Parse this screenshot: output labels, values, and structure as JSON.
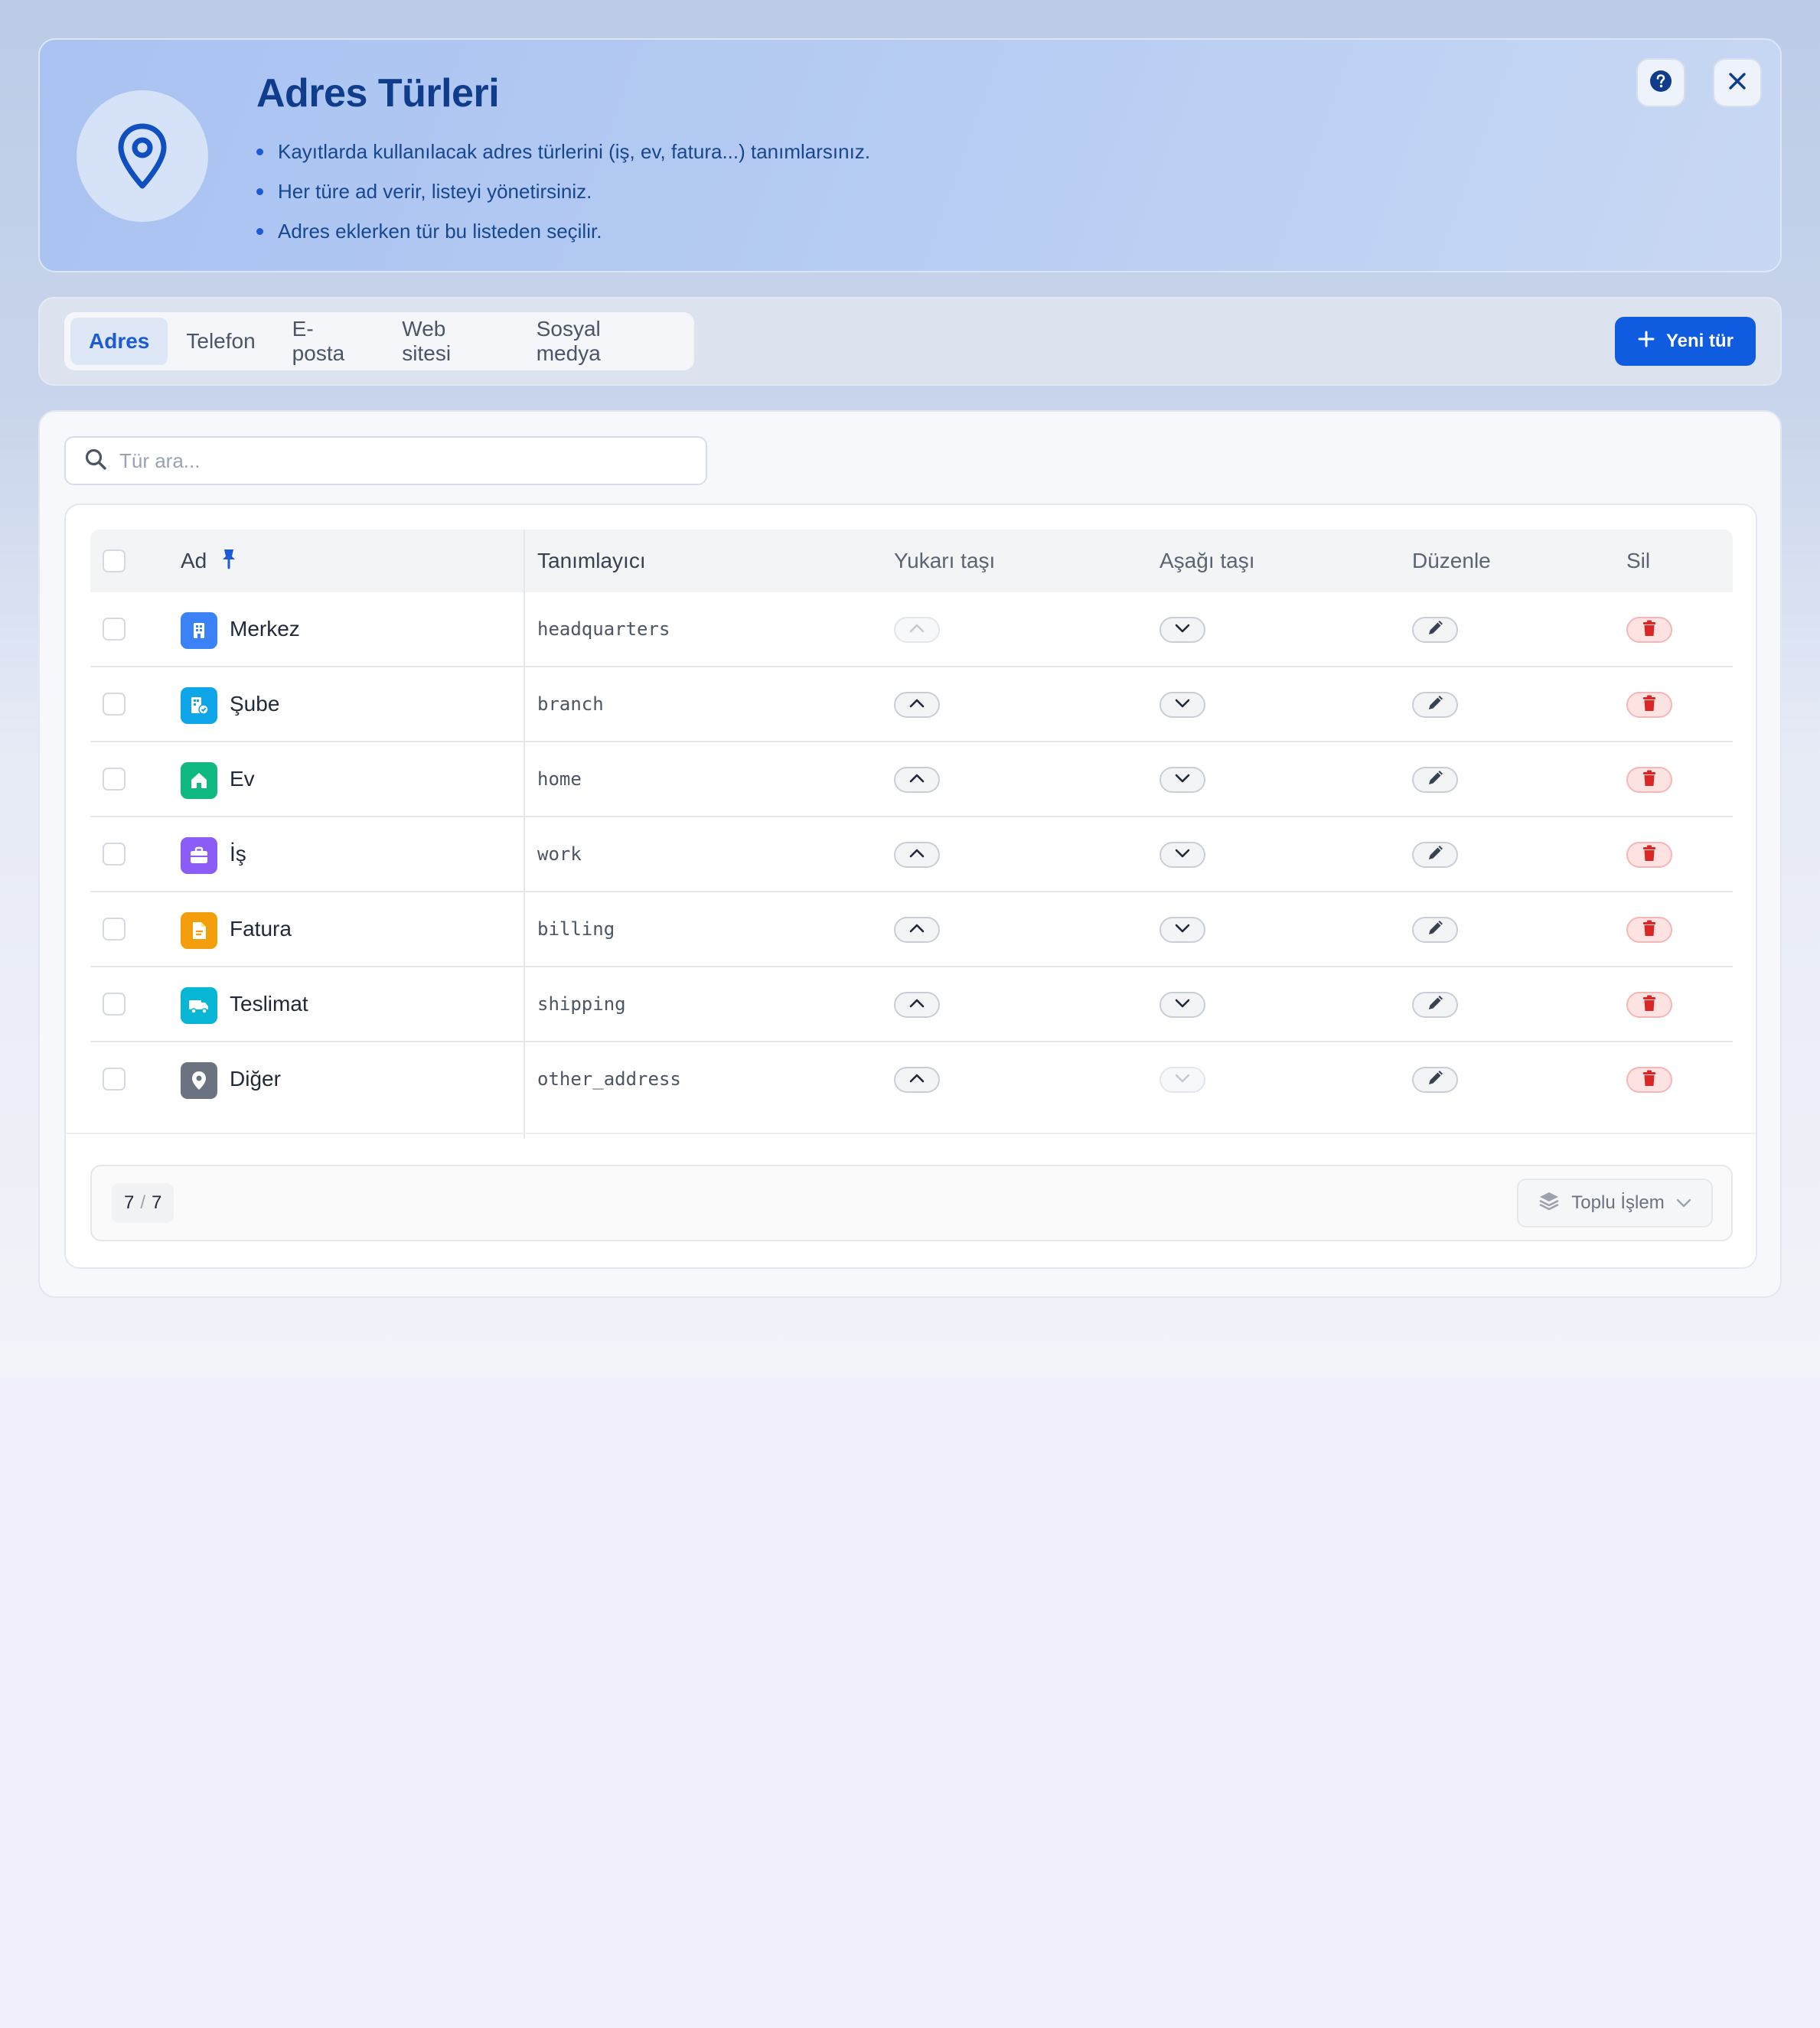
{
  "header": {
    "title": "Adres Türleri",
    "bullets": [
      "Kayıtlarda kullanılacak adres türlerini (iş, ev, fatura...) tanımlarsınız.",
      "Her türe ad verir, listeyi yönetirsiniz.",
      "Adres eklerken tür bu listeden seçilir."
    ],
    "icon": "map-pin-icon",
    "help_icon": "help-circle-icon",
    "close_icon": "close-icon"
  },
  "tabs": [
    {
      "label": "Adres",
      "active": true
    },
    {
      "label": "Telefon",
      "active": false
    },
    {
      "label": "E-posta",
      "active": false
    },
    {
      "label": "Web sitesi",
      "active": false
    },
    {
      "label": "Sosyal medya",
      "active": false
    }
  ],
  "new_button": {
    "label": "Yeni tür",
    "icon": "plus-icon"
  },
  "search": {
    "placeholder": "Tür ara...",
    "value": ""
  },
  "table": {
    "columns": {
      "name": "Ad",
      "identifier": "Tanımlayıcı",
      "move_up": "Yukarı taşı",
      "move_down": "Aşağı taşı",
      "edit": "Düzenle",
      "delete": "Sil"
    },
    "rows": [
      {
        "name": "Merkez",
        "slug": "headquarters",
        "icon": "building-icon",
        "color": "#3b82f6",
        "up_disabled": true,
        "down_disabled": false
      },
      {
        "name": "Şube",
        "slug": "branch",
        "icon": "branch-building-icon",
        "color": "#0ea5e9",
        "up_disabled": false,
        "down_disabled": false
      },
      {
        "name": "Ev",
        "slug": "home",
        "icon": "home-icon",
        "color": "#10b981",
        "up_disabled": false,
        "down_disabled": false
      },
      {
        "name": "İş",
        "slug": "work",
        "icon": "briefcase-icon",
        "color": "#8b5cf6",
        "up_disabled": false,
        "down_disabled": false
      },
      {
        "name": "Fatura",
        "slug": "billing",
        "icon": "invoice-icon",
        "color": "#f59e0b",
        "up_disabled": false,
        "down_disabled": false
      },
      {
        "name": "Teslimat",
        "slug": "shipping",
        "icon": "truck-icon",
        "color": "#06b6d4",
        "up_disabled": false,
        "down_disabled": false
      },
      {
        "name": "Diğer",
        "slug": "other_address",
        "icon": "location-icon",
        "color": "#6b7280",
        "up_disabled": false,
        "down_disabled": true
      }
    ]
  },
  "footer": {
    "count_shown": "7",
    "count_sep": "/",
    "count_total": "7",
    "bulk_label": "Toplu İşlem"
  },
  "colors": {
    "accent": "#0f5ce0",
    "danger": "#dc2626",
    "title": "#0f3d8c"
  }
}
